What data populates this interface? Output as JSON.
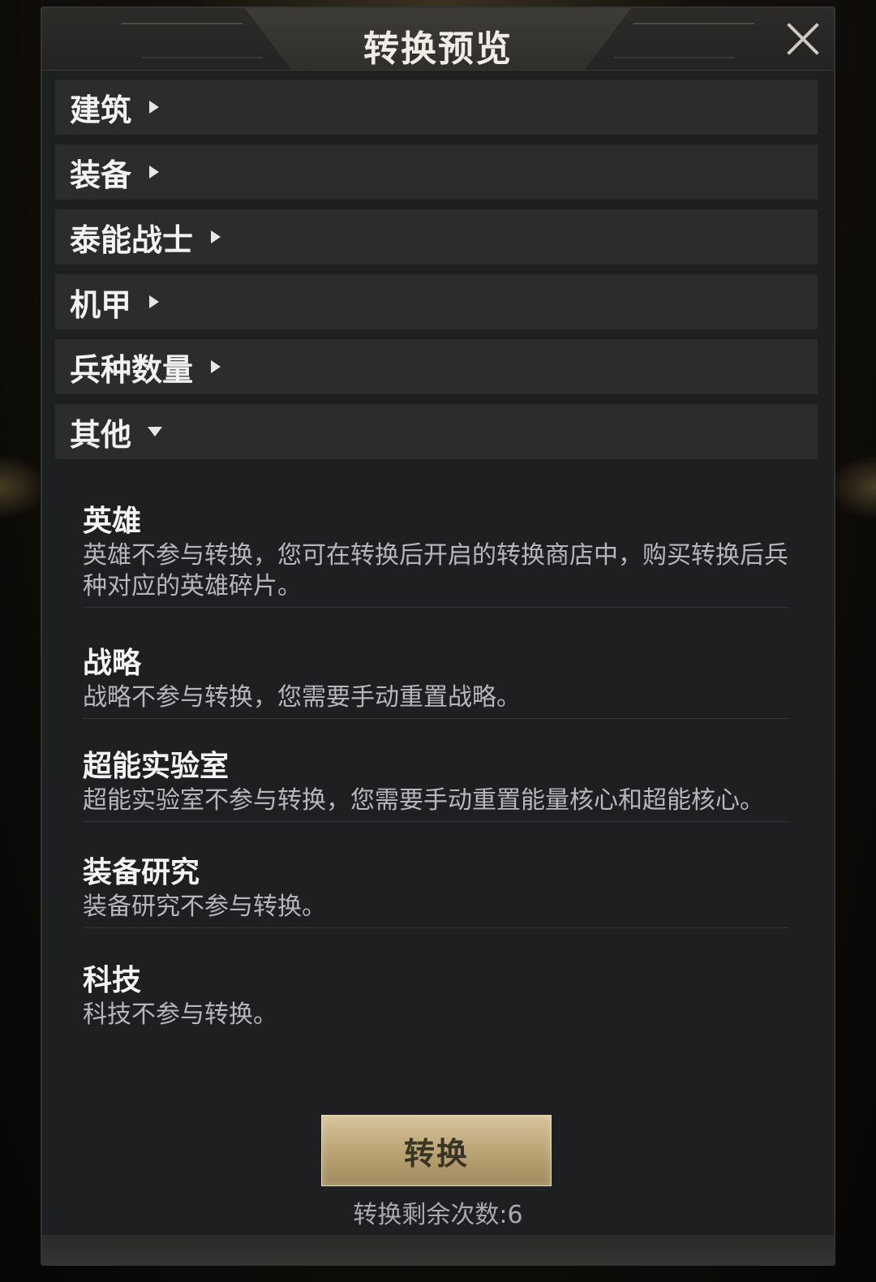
{
  "dialog": {
    "title": "转换预览",
    "close_icon": "close-icon"
  },
  "categories": [
    {
      "label": "建筑",
      "expanded": false
    },
    {
      "label": "装备",
      "expanded": false
    },
    {
      "label": "泰能战士",
      "expanded": false
    },
    {
      "label": "机甲",
      "expanded": false
    },
    {
      "label": "兵种数量",
      "expanded": false
    },
    {
      "label": "其他",
      "expanded": true
    }
  ],
  "other_items": [
    {
      "title": "英雄",
      "desc": "英雄不参与转换，您可在转换后开启的转换商店中，购买转换后兵种对应的英雄碎片。"
    },
    {
      "title": "战略",
      "desc": "战略不参与转换，您需要手动重置战略。"
    },
    {
      "title": "超能实验室",
      "desc": "超能实验室不参与转换，您需要手动重置能量核心和超能核心。"
    },
    {
      "title": "装备研究",
      "desc": "装备研究不参与转换。"
    },
    {
      "title": "科技",
      "desc": "科技不参与转换。"
    }
  ],
  "actions": {
    "convert_label": "转换",
    "remaining_text": "转换剩余次数:6"
  },
  "colors": {
    "panel": "#1e1f21",
    "row": "#2b2c2e",
    "button_gold": "#c2ab7c"
  }
}
